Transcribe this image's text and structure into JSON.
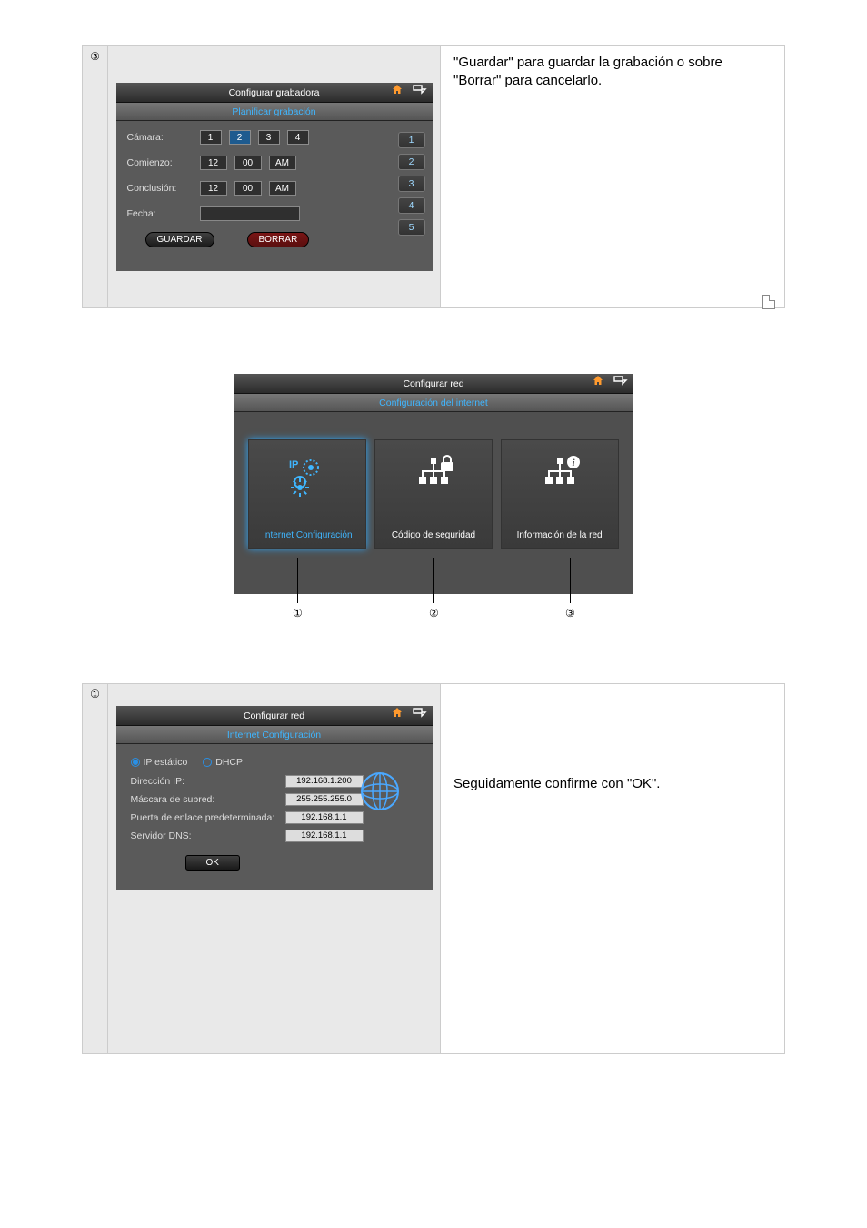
{
  "recorder_panel": {
    "circ": "③",
    "title": "Configurar grabadora",
    "subtitle": "Planificar grabación",
    "labels": {
      "camera": "Cámara:",
      "start": "Comienzo:",
      "end": "Conclusión:",
      "date": "Fecha:"
    },
    "camera_buttons": [
      "1",
      "2",
      "3",
      "4"
    ],
    "start_vals": [
      "12",
      "00",
      "AM"
    ],
    "end_vals": [
      "12",
      "00",
      "AM"
    ],
    "save_btn": "GUARDAR",
    "delete_btn": "BORRAR",
    "slots": [
      "1",
      "2",
      "3",
      "4",
      "5"
    ],
    "description": "\"Guardar\" para guardar la grabación o sobre \"Borrar\" para cancelarlo."
  },
  "network_menu": {
    "title": "Configurar red",
    "subtitle": "Configuración del internet",
    "tiles": [
      {
        "label": "Internet Configuración",
        "active": true
      },
      {
        "label": "Código de seguridad",
        "active": false
      },
      {
        "label": "Información de la red",
        "active": false
      }
    ],
    "callouts": [
      "①",
      "②",
      "③"
    ]
  },
  "netconf_panel": {
    "circ": "①",
    "title": "Configurar red",
    "subtitle": "Internet Configuración",
    "radio_static": "IP estático",
    "radio_dhcp": "DHCP",
    "rows": {
      "ip_label": "Dirección IP:",
      "ip_val": "192.168.1.200",
      "mask_label": "Máscara de subred:",
      "mask_val": "255.255.255.0",
      "gw_label": "Puerta de enlace predeterminada:",
      "gw_val": "192.168.1.1",
      "dns_label": "Servidor DNS:",
      "dns_val": "192.168.1.1"
    },
    "ok_btn": "OK",
    "description": "Seguidamente confirme con \"OK\"."
  }
}
